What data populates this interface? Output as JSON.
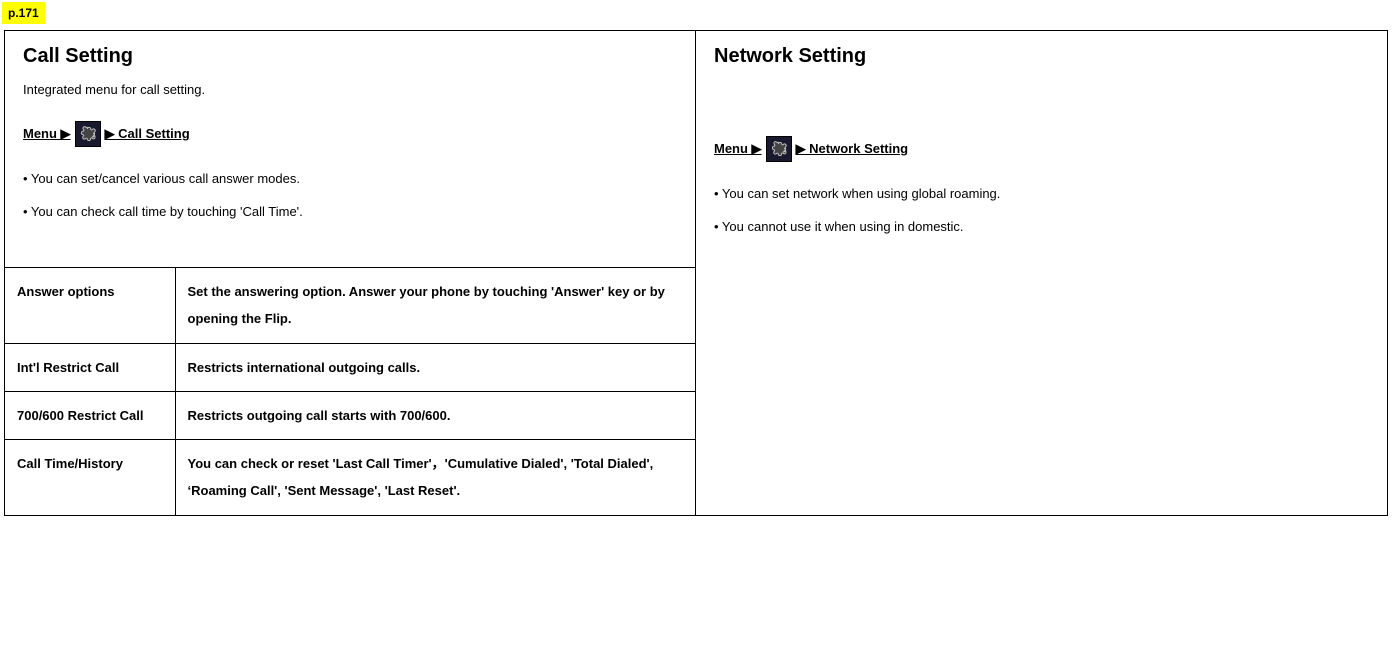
{
  "page_label": "p.171",
  "left": {
    "title": "Call Setting",
    "subtitle": "Integrated menu for call setting.",
    "path": {
      "p1": "Menu ▶",
      "p2": "▶ Call Setting"
    },
    "bullets": [
      "• You can set/cancel various call answer modes.",
      "• You can check call time by touching 'Call Time'."
    ],
    "table": [
      {
        "k": "Answer options",
        "v": "Set the answering option. Answer your phone by touching 'Answer' key or by opening the Flip."
      },
      {
        "k": "Int'l Restrict Call",
        "v": "Restricts international outgoing calls."
      },
      {
        "k": "700/600 Restrict Call",
        "v": "Restricts outgoing call starts with 700/600."
      },
      {
        "k": "Call Time/History",
        "v": "You can check or reset 'Last Call Timer'，'Cumulative Dialed', 'Total Dialed', ‘Roaming Call', 'Sent Message', 'Last Reset'."
      }
    ]
  },
  "right": {
    "title": "Network Setting",
    "path": {
      "p1": "Menu ▶",
      "p2": "▶ Network Setting"
    },
    "bullets": [
      "• You can set network when using global roaming.",
      "• You cannot use it when using in domestic."
    ]
  }
}
